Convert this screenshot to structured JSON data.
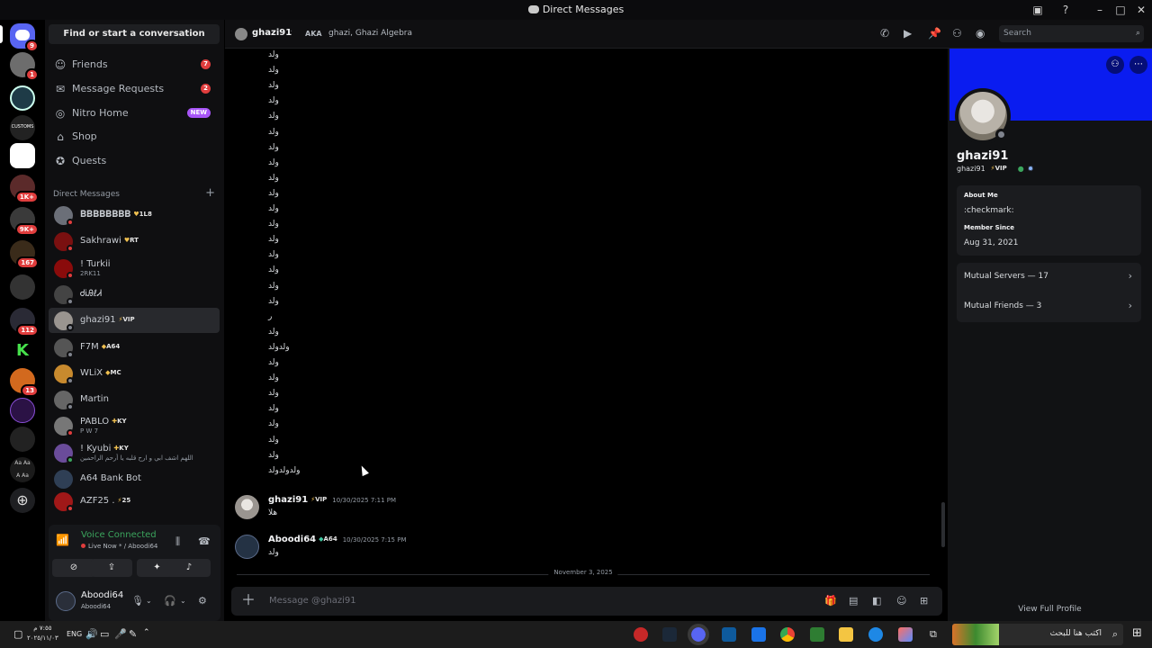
{
  "window": {
    "title": "Direct Messages"
  },
  "rail": {
    "badges": [
      "9",
      "1",
      "1K+",
      "9K+",
      "167",
      "112",
      "13"
    ],
    "server_labels": [
      "CUSTOMS"
    ]
  },
  "sidebar": {
    "search_label": "Find or start a conversation",
    "nav": [
      {
        "label": "Friends",
        "count": "7",
        "icon": "friends-icon"
      },
      {
        "label": "Message Requests",
        "count": "2",
        "icon": "envelope-icon"
      },
      {
        "label": "Nitro Home",
        "badge": "NEW",
        "icon": "nitro-icon"
      },
      {
        "label": "Shop",
        "icon": "shop-icon"
      },
      {
        "label": "Quests",
        "icon": "quests-icon"
      }
    ],
    "dm_header": "Direct Messages",
    "dms": [
      {
        "name": "𝐁𝐁𝐁𝐁𝐁𝐁𝐁𝐁",
        "tag": "1L8",
        "tag_symbol": "♥",
        "sub": "",
        "color": "#6b6f78",
        "status": "#e03d3d"
      },
      {
        "name": "Sakhrawi",
        "tag": "RT",
        "tag_symbol": "♥",
        "sub": "",
        "color": "#7a1010",
        "status": "#e03d3d"
      },
      {
        "name": "! Turkii",
        "tag": "",
        "tag_symbol": "",
        "sub": "2RK11",
        "color": "#8a0b0b",
        "status": "#e03d3d"
      },
      {
        "name": "ᏧᎥᎯℓᏗ",
        "tag": "",
        "tag_symbol": "",
        "sub": "",
        "color": "#444",
        "status": "#80848e"
      },
      {
        "name": "ghazi91",
        "tag": "VIP",
        "tag_symbol": "⚡",
        "sub": "",
        "color": "#9a9590",
        "status": "#80848e"
      },
      {
        "name": "F7M",
        "tag": "A64",
        "tag_symbol": "◆",
        "sub": "",
        "color": "#555",
        "status": "#80848e"
      },
      {
        "name": "WLiX",
        "tag": "MC",
        "tag_symbol": "◆",
        "sub": "",
        "color": "#c88a2e",
        "status": "#80848e"
      },
      {
        "name": "Martin",
        "tag": "",
        "tag_symbol": "",
        "sub": "",
        "color": "#666",
        "status": "#80848e"
      },
      {
        "name": "PABLO",
        "tag": "KY",
        "tag_symbol": "✚",
        "sub": "P W 7",
        "color": "#777",
        "status": "#e03d3d"
      },
      {
        "name": "! Kyubi",
        "tag": "KY",
        "tag_symbol": "✚",
        "sub": "اللهم اشف ابي و ارح قلبه يا أرحم الراحمين",
        "color": "#6a4c9a",
        "status": "#3ba55d"
      },
      {
        "name": "A64 Bank Bot",
        "tag": "",
        "tag_symbol": "",
        "sub": "",
        "color": "#2f3f55",
        "status": ""
      },
      {
        "name": "AZF25 .",
        "tag": "25",
        "tag_symbol": "⚡",
        "sub": "",
        "color": "#a01818",
        "status": "#e03d3d"
      }
    ]
  },
  "voice": {
    "title": "Voice Connected",
    "subtitle": "Live Now * / Aboodi64"
  },
  "user": {
    "name": "Aboodi64",
    "status": "Aboodi64"
  },
  "chat_header": {
    "name": "ghazi91",
    "aka_label": "AKA",
    "aka_value": "ghazi, Ghazi Algebra",
    "search_placeholder": "Search"
  },
  "chat": {
    "lines": [
      "ولد",
      "ولد",
      "ولد",
      "ولد",
      "ولد",
      "ولد",
      "ولد",
      "ولد",
      "ولد",
      "ولد",
      "ولد",
      "ولد",
      "ولد",
      "ولد",
      "ولد",
      "ولد",
      "ولد",
      "ر",
      "ولد",
      "ولدولد",
      "ولد",
      "ولد",
      "ولد",
      "ولد",
      "ولد",
      "ولد",
      "ولد",
      "ولدولدولد"
    ],
    "messages": [
      {
        "author": "ghazi91",
        "tag": "VIP",
        "tag_symbol": "⚡",
        "time": "10/30/2025 7:11 PM",
        "text": "هلا"
      },
      {
        "author": "Aboodi64",
        "tag": "A64",
        "tag_symbol": "◆",
        "time": "10/30/2025 7:15 PM",
        "text": "ولد"
      }
    ],
    "divider": "November 3, 2025",
    "composer_placeholder": "Message @ghazi91"
  },
  "profile": {
    "display_name": "ghazi91",
    "username": "ghazi91",
    "tag": "VIP",
    "tag_symbol": "⚡",
    "about_label": "About Me",
    "about_value": ":checkmark:",
    "member_since_label": "Member Since",
    "member_since_value": "Aug 31, 2021",
    "mutual_servers": "Mutual Servers — 17",
    "mutual_friends": "Mutual Friends — 3",
    "view_full": "View Full Profile",
    "banner_color": "#0a1cf0"
  },
  "taskbar": {
    "lang": "ENG",
    "time": "٧:٥٥ م",
    "date": "٢٠٢٥/١١/٠٣",
    "search_text": "اكتب هنا للبحث"
  }
}
